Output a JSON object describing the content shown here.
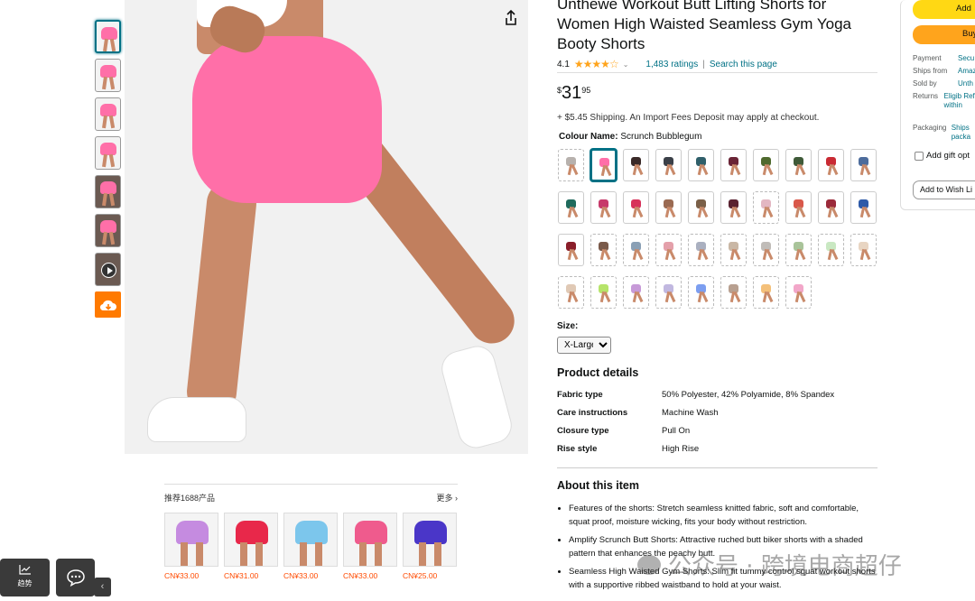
{
  "product": {
    "title": "Unthewe Workout Butt Lifting Shorts for Women High Waisted Seamless Gym Yoga Booty Shorts",
    "rating_value": "4.1",
    "stars": "★★★★☆",
    "ratings_count": "1,483 ratings",
    "search_page_link": "Search this page",
    "separator": "|",
    "price_symbol": "$",
    "price_whole": "31",
    "price_fraction": "95",
    "shipping": "+ $5.45 Shipping. An Import Fees Deposit may apply at checkout.",
    "colour_label": "Colour Name:",
    "colour_value": "Scrunch Bubblegum",
    "size_label": "Size:",
    "size_selected": "X-Large"
  },
  "swatch_colors": [
    "#b7b1ad",
    "#ff6fa8",
    "#3a2a28",
    "#3b4048",
    "#2f5f6a",
    "#6a2436",
    "#4f6a2e",
    "#3f5a38",
    "#c92a33",
    "#4d6c9c",
    "#1f6a5c",
    "#c73a6a",
    "#d7325a",
    "#9a6a52",
    "#7a6048",
    "#5a2230",
    "#e3b7c2",
    "#d9584a",
    "#9b2a3a",
    "#2e5aa8",
    "#8a1e2a",
    "#7a5a4a",
    "#8aa0b5",
    "#e4a0aa",
    "#aab0c0",
    "#c9b7a5",
    "#c0bcb8",
    "#a9c49a",
    "#c9e8c2",
    "#e8d5c2",
    "#e0c9b5",
    "#b6e46a",
    "#c79ad8",
    "#c1b8e0",
    "#7c9ef0",
    "#b8a090",
    "#f4c07a",
    "#f2a7c9"
  ],
  "product_details": {
    "heading": "Product details",
    "rows": [
      {
        "key": "Fabric type",
        "value": "50% Polyester, 42% Polyamide, 8% Spandex"
      },
      {
        "key": "Care instructions",
        "value": "Machine Wash"
      },
      {
        "key": "Closure type",
        "value": "Pull On"
      },
      {
        "key": "Rise style",
        "value": "High Rise"
      }
    ]
  },
  "about": {
    "heading": "About this item",
    "bullets": [
      "Features of the shorts: Stretch seamless knitted fabric, soft and comfortable, squat proof, moisture wicking, fits your body without restriction.",
      "Amplify Scrunch Butt Shorts: Attractive ruched butt biker shorts with a shaded pattern that enhances the peachy butt.",
      "Seamless High Waisted Gym Shorts: Slim fit tummy control squat workout shorts with a supportive ribbed waistband to hold at your waist."
    ]
  },
  "buy_box": {
    "add_to_cart": "Add",
    "buy_now": "Buy",
    "rows": [
      {
        "key": "Payment",
        "value": "Secu"
      },
      {
        "key": "Ships from",
        "value": "Amaz"
      },
      {
        "key": "Sold by",
        "value": "Unth"
      },
      {
        "key": "Returns",
        "value": "Eligib Refun within"
      },
      {
        "key": "Packaging",
        "value": "Ships packa"
      }
    ],
    "gift": "Add gift opt",
    "wishlist": "Add to Wish Li"
  },
  "recommendations": {
    "heading": "推荐1688产品",
    "more": "更多 ›",
    "items": [
      {
        "price": "CN¥33.00",
        "color": "#c58be0"
      },
      {
        "price": "CN¥31.00",
        "color": "#e8284a"
      },
      {
        "price": "CN¥33.00",
        "color": "#7cc6ec"
      },
      {
        "price": "CN¥33.00",
        "color": "#ef5b8d"
      },
      {
        "price": "CN¥25.00",
        "color": "#4a36c8"
      }
    ]
  },
  "widgets": {
    "trend_label": "趋势",
    "collapse": "‹"
  },
  "watermark": "公众号 · 跨境电商超仔"
}
